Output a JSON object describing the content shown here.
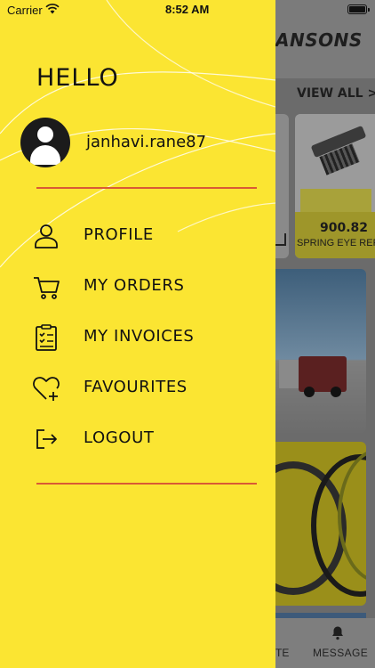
{
  "status_bar": {
    "carrier": "Carrier",
    "time": "8:52 AM"
  },
  "background": {
    "brand": "ANSONS",
    "view_all": "VIEW ALL >",
    "product_price": "900.82",
    "product_name": "SPRING EYE REP",
    "tab_left": "TE",
    "tab_message": "MESSAGE"
  },
  "drawer": {
    "greeting": "HELLO",
    "username": "janhavi.rane87",
    "menu": [
      {
        "label": "PROFILE",
        "icon": "person-icon"
      },
      {
        "label": "MY ORDERS",
        "icon": "cart-icon"
      },
      {
        "label": "MY INVOICES",
        "icon": "clipboard-checklist-icon"
      },
      {
        "label": "FAVOURITES",
        "icon": "heart-plus-icon"
      },
      {
        "label": "LOGOUT",
        "icon": "logout-icon"
      }
    ]
  },
  "colors": {
    "drawer_bg": "#fbe532",
    "divider": "#d95a35",
    "text": "#111111"
  }
}
